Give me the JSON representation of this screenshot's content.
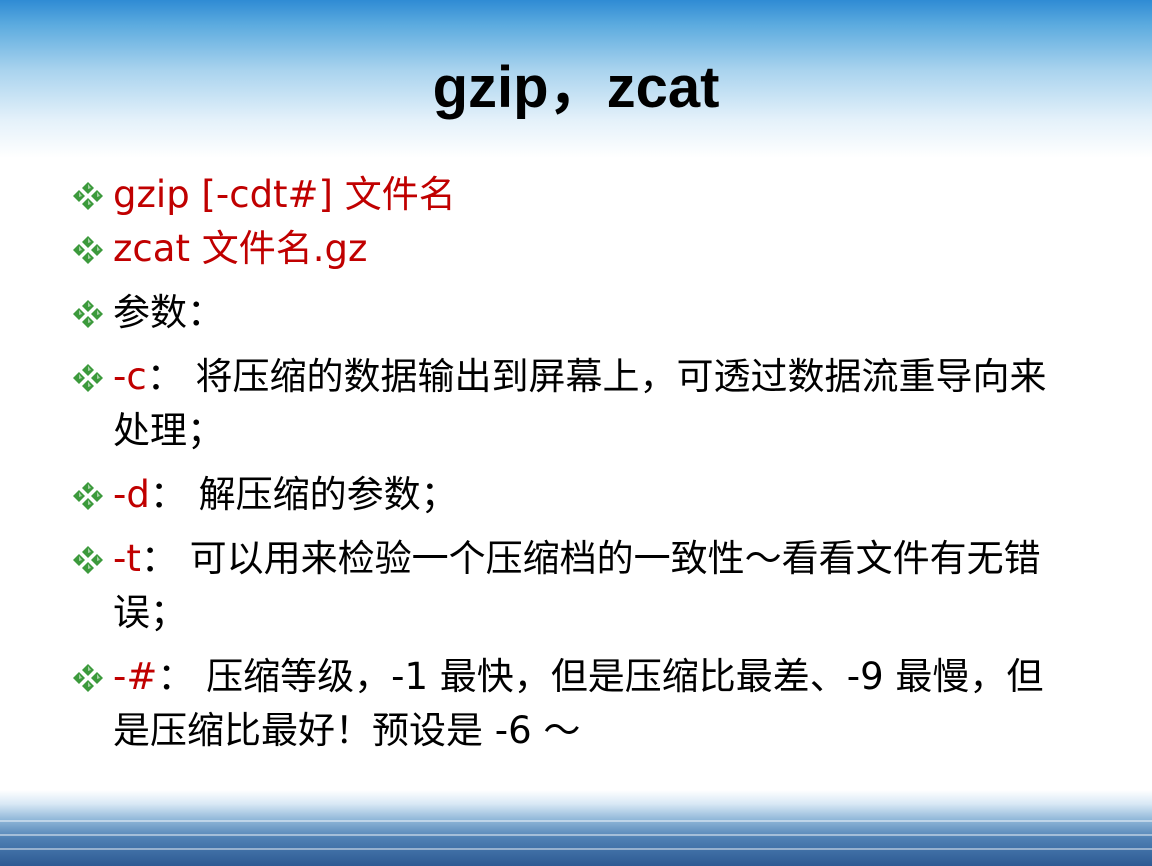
{
  "colors": {
    "accent_red": "#c00000",
    "bullet_green": "#3c9a3c",
    "text": "#000000",
    "band_blue": "#2f8bd4"
  },
  "title": "gzip，zcat",
  "bullet_icon": "diamond-bullet-icon",
  "items": [
    {
      "key": "gzip [-cdt#] 文件名",
      "text": ""
    },
    {
      "key": "zcat 文件名.gz",
      "text": ""
    },
    {
      "key": "",
      "text": "参数："
    },
    {
      "key": "-c",
      "text": "： 将压缩的数据输出到屏幕上，可透过数据流重导向来处理；"
    },
    {
      "key": "-d",
      "text": "： 解压缩的参数；"
    },
    {
      "key": "-t",
      "text": "： 可以用来检验一个压缩档的一致性～看看文件有无错误；"
    },
    {
      "key": "-#",
      "text": "： 压缩等级，-1 最快，但是压缩比最差、-9 最慢，但是压缩比最好！预设是 -6 ～"
    }
  ]
}
